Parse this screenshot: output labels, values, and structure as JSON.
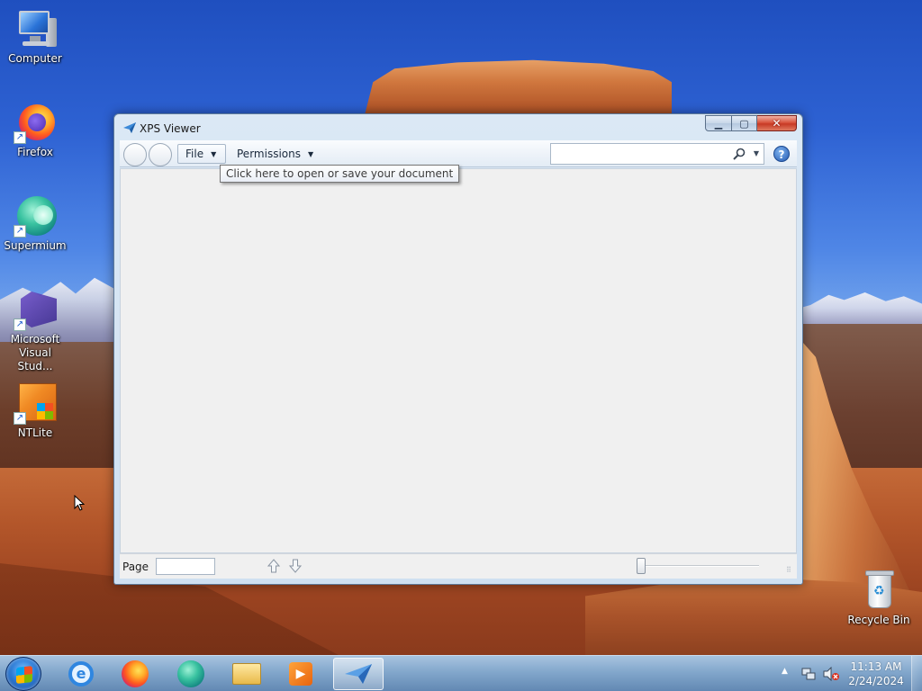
{
  "desktop": {
    "icons": [
      {
        "label": "Computer",
        "icon": "computer-icon"
      },
      {
        "label": "Firefox",
        "icon": "firefox-icon"
      },
      {
        "label": "Supermium",
        "icon": "supermium-icon"
      },
      {
        "label": "Microsoft Visual Stud...",
        "icon": "visual-studio-icon"
      },
      {
        "label": "NTLite",
        "icon": "ntlite-icon"
      },
      {
        "label": "Recycle Bin",
        "icon": "recycle-bin-icon"
      }
    ]
  },
  "window": {
    "title": "XPS Viewer",
    "toolbar": {
      "file_label": "File",
      "permissions_label": "Permissions",
      "search_placeholder": ""
    },
    "tooltip": "Click here to open or save your document",
    "statusbar": {
      "page_label": "Page",
      "page_value": ""
    }
  },
  "taskbar": {
    "apps": [
      "internet-explorer-icon",
      "firefox-icon",
      "supermium-icon",
      "file-explorer-icon",
      "media-player-icon",
      "xps-viewer-icon"
    ],
    "active_app": "xps-viewer-icon",
    "clock": {
      "time": "11:13 AM",
      "date": "2/24/2024"
    }
  },
  "colors": {
    "title_text": "#1a1a1a",
    "close_button": "#c73a25",
    "taskbar": "#7aa0c8",
    "help_icon": "#2459b0"
  }
}
